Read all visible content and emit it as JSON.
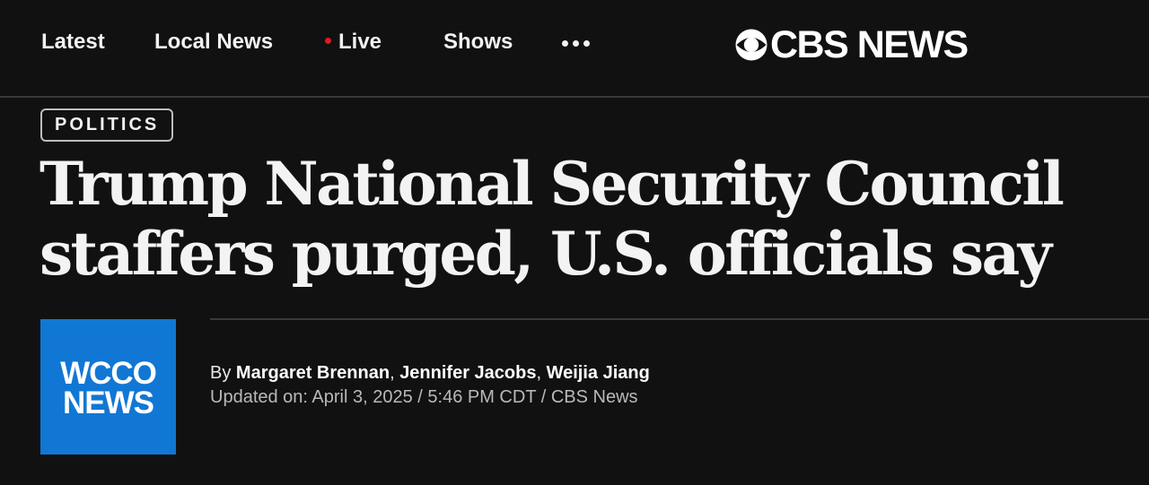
{
  "nav": {
    "items": [
      {
        "label": "Latest"
      },
      {
        "label": "Local News"
      },
      {
        "label": "Live"
      },
      {
        "label": "Shows"
      }
    ],
    "more_icon": "more-dots-icon"
  },
  "logo": {
    "text": "CBS NEWS",
    "icon": "cbs-eye-icon"
  },
  "article": {
    "category": "POLITICS",
    "headline": "Trump National Security Council staffers purged, U.S. officials say",
    "station_logo": {
      "line1": "WCCO",
      "line2": "NEWS"
    },
    "byline": {
      "prefix": "By",
      "authors": [
        "Margaret Brennan",
        "Jennifer Jacobs",
        "Weijia Jiang"
      ],
      "separator": ","
    },
    "dateline": "Updated on: April 3, 2025 / 5:46 PM CDT / CBS News"
  },
  "colors": {
    "background": "#111111",
    "live_dot": "#e0191e",
    "station_logo_bg": "#1177d4",
    "divider": "#3a3a3a"
  }
}
